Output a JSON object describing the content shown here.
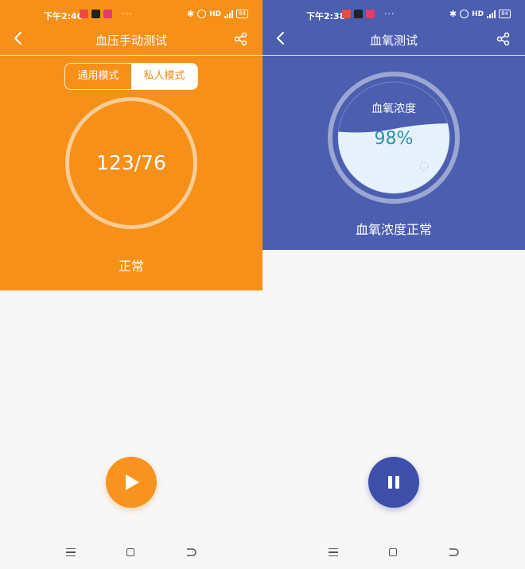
{
  "left": {
    "status_bar": {
      "time": "下午2:40",
      "network": "HD",
      "battery": "84"
    },
    "header": {
      "title": "血压手动测试"
    },
    "modes": [
      {
        "label": "通用模式",
        "active": false
      },
      {
        "label": "私人模式",
        "active": true
      }
    ],
    "reading": {
      "value": "123/76"
    },
    "result": "正常",
    "action_button": {
      "icon": "play-icon"
    },
    "theme": {
      "hero_bg": "#f79019",
      "button_bg": "#f7931e"
    }
  },
  "right": {
    "status_bar": {
      "time": "下午2:38",
      "network": "HD",
      "battery": "84"
    },
    "header": {
      "title": "血氧测试"
    },
    "gauge": {
      "label": "血氧浓度",
      "value": "98%",
      "fill_level": 0.6
    },
    "result": "血氧浓度正常",
    "action_button": {
      "icon": "pause-icon"
    },
    "theme": {
      "hero_bg": "#4b5eb0",
      "button_bg": "#3f4ea8",
      "value_color": "#2a93a8"
    }
  },
  "icons": {
    "back": "back-arrow-icon",
    "share": "share-icon",
    "nav": [
      "menu-icon",
      "home-icon",
      "back-icon"
    ]
  }
}
